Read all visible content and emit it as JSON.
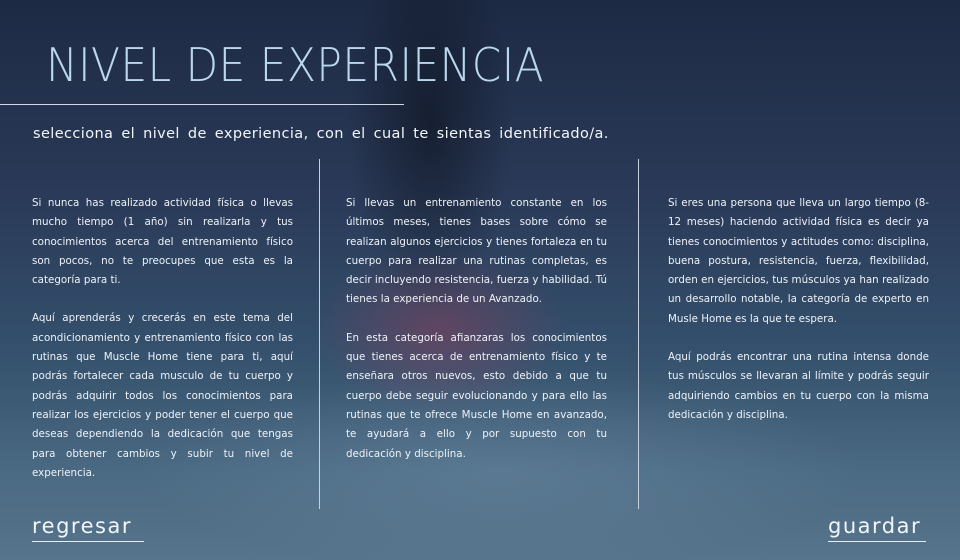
{
  "header": {
    "title": "NIVEL DE EXPERIENCIA",
    "subtitle": "selecciona el nivel de experiencia, con el cual te sientas identificado/a."
  },
  "levels": [
    {
      "paragraphs": [
        "Si nunca has realizado actividad física o llevas mucho tiempo (1 año) sin realizarla y tus conocimientos acerca del entrenamiento físico son pocos, no te preocupes que esta es la categoría para ti.",
        "Aquí aprenderás y crecerás en este tema del acondicionamiento y entrenamiento físico con las rutinas que Muscle Home tiene para ti, aquí podrás  fortalecer cada musculo de tu cuerpo y podrás adquirir todos los conocimientos para realizar los ejercicios y poder tener el cuerpo que deseas dependiendo la dedicación que tengas para obtener cambios y subir tu nivel de experiencia."
      ]
    },
    {
      "paragraphs": [
        "Si llevas un entrenamiento constante en los últimos meses, tienes bases sobre cómo se realizan algunos ejercicios y tienes fortaleza en tu cuerpo para realizar una rutinas completas, es decir incluyendo resistencia, fuerza y habilidad. Tú tienes la experiencia de un Avanzado.",
        "En esta categoría afianzaras los conocimientos que tienes acerca de entrenamiento físico y te enseñara otros nuevos, esto debido a que tu cuerpo debe seguir evolucionando y para ello las rutinas que te ofrece Muscle Home en avanzado, te ayudará a ello y por supuesto con tu dedicación y disciplina."
      ]
    },
    {
      "paragraphs": [
        "Si eres una persona que lleva un largo tiempo (8-12 meses) haciendo actividad física es decir ya tienes conocimientos y actitudes como: disciplina, buena postura, resistencia, fuerza, flexibilidad, orden en ejercicios, tus músculos ya han realizado un desarrollo notable, la categoría de experto en Musle Home es la que te espera.",
        "Aquí podrás encontrar una rutina intensa donde tus músculos se llevaran al límite y podrás seguir adquiriendo cambios en tu cuerpo con la misma dedicación y disciplina."
      ]
    }
  ],
  "nav": {
    "back_label": "regresar",
    "save_label": "guardar"
  }
}
